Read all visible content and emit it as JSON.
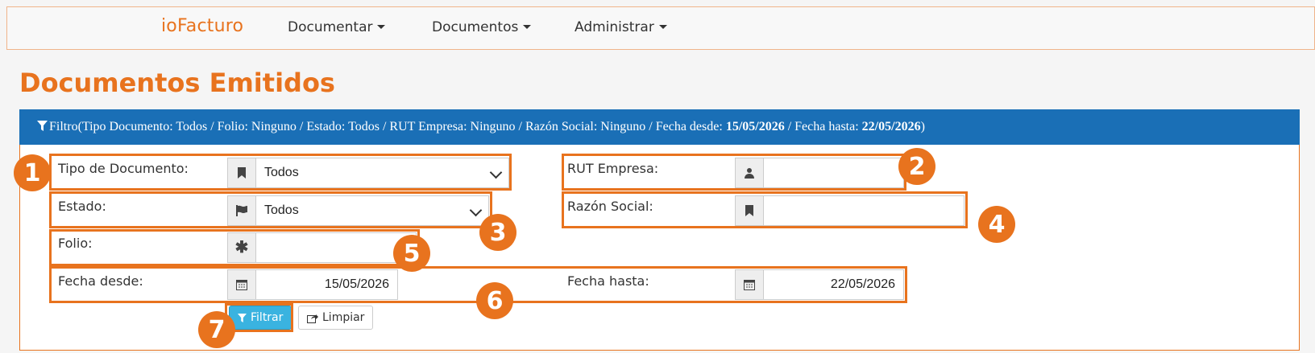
{
  "navbar": {
    "brand": "ioFacturo",
    "items": [
      "Documentar",
      "Documentos",
      "Administrar"
    ]
  },
  "page_title": "Documentos Emitidos",
  "filter_header": {
    "prefix": "Filtro(Tipo Documento: Todos / Folio: Ninguno / Estado: Todos / RUT Empresa: Ninguno / Razón Social: Ninguno / Fecha desde: ",
    "date_from": "15/05/2026",
    "middle": " / Fecha hasta: ",
    "date_to": "22/05/2026",
    "suffix": ")"
  },
  "form": {
    "tipo_documento": {
      "label": "Tipo de Documento:",
      "value": "Todos"
    },
    "estado": {
      "label": "Estado:",
      "value": "Todos"
    },
    "folio": {
      "label": "Folio:",
      "value": ""
    },
    "rut_empresa": {
      "label": "RUT Empresa:",
      "value": ""
    },
    "razon_social": {
      "label": "Razón Social:",
      "value": ""
    },
    "fecha_desde": {
      "label": "Fecha desde:",
      "value": "15/05/2026"
    },
    "fecha_hasta": {
      "label": "Fecha hasta:",
      "value": "22/05/2026"
    }
  },
  "buttons": {
    "filtrar": "Filtrar",
    "limpiar": "Limpiar"
  },
  "callouts": [
    "1",
    "2",
    "3",
    "4",
    "5",
    "6",
    "7"
  ],
  "colors": {
    "accent": "#e8731e",
    "header_blue": "#1a6fb6",
    "button_primary": "#3ab3e0"
  }
}
